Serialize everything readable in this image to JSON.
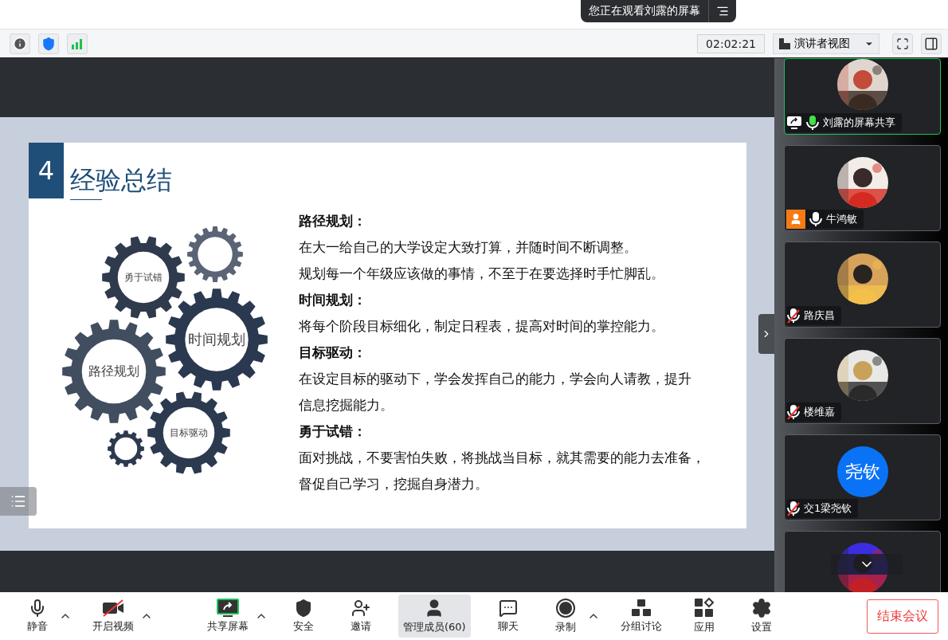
{
  "banner": {
    "text": "您正在观看刘露的屏幕"
  },
  "toolbar": {
    "timer": "02:02:21",
    "view_label": "演讲者视图"
  },
  "slide": {
    "number": "4",
    "title": "经验总结",
    "gears": [
      {
        "label": "勇于试错"
      },
      {
        "label": "时间规划"
      },
      {
        "label": "路径规划"
      },
      {
        "label": "目标驱动"
      }
    ],
    "lines": [
      {
        "kind": "heading",
        "text": "路径规划："
      },
      {
        "kind": "body",
        "text": "在大一给自己的大学设定大致打算，并随时间不断调整。"
      },
      {
        "kind": "body",
        "text": "规划每一个年级应该做的事情，不至于在要选择时手忙脚乱。"
      },
      {
        "kind": "heading",
        "text": "时间规划："
      },
      {
        "kind": "body",
        "text": "将每个阶段目标细化，制定日程表，提高对时间的掌控能力。"
      },
      {
        "kind": "heading",
        "text": "目标驱动："
      },
      {
        "kind": "body",
        "text": "在设定目标的驱动下，学会发挥自己的能力，学会向人请教，提升"
      },
      {
        "kind": "body",
        "text": "信息挖掘能力。"
      },
      {
        "kind": "heading",
        "text": "勇于试错："
      },
      {
        "kind": "body",
        "text": "面对挑战，不要害怕失败，将挑战当目标，就其需要的能力去准备，"
      },
      {
        "kind": "body",
        "text": "督促自己学习，挖掘自身潜力。"
      }
    ]
  },
  "participants": [
    {
      "name": "刘露的屏幕共享",
      "sharing_screen": true,
      "host": false,
      "muted": false,
      "speaking": true,
      "selected": true
    },
    {
      "name": "牛鸿敏",
      "sharing_screen": false,
      "host": true,
      "muted": false,
      "speaking": false,
      "selected": false
    },
    {
      "name": "路庆昌",
      "sharing_screen": false,
      "host": false,
      "muted": true,
      "speaking": false,
      "selected": false
    },
    {
      "name": "楼维嘉",
      "sharing_screen": false,
      "host": false,
      "muted": true,
      "speaking": false,
      "selected": false
    },
    {
      "name": "交1梁尧钦",
      "sharing_screen": false,
      "host": false,
      "muted": true,
      "speaking": false,
      "selected": false,
      "avatar": {
        "kind": "initials",
        "text": "尧钦"
      }
    },
    {
      "selected": false
    }
  ],
  "controls": [
    {
      "kind": "mic",
      "label": "静音",
      "menu": true,
      "selected": false
    },
    {
      "kind": "video",
      "label": "开启视频",
      "menu": true,
      "selected": false
    },
    {
      "kind": "share",
      "label": "共享屏幕",
      "menu": true,
      "selected": false
    },
    {
      "kind": "security",
      "label": "安全",
      "menu": false,
      "selected": false
    },
    {
      "kind": "invite",
      "label": "邀请",
      "menu": false,
      "selected": false
    },
    {
      "kind": "members",
      "label": "管理成员(60)",
      "menu": false,
      "selected": true
    },
    {
      "kind": "chat",
      "label": "聊天",
      "menu": false,
      "selected": false
    },
    {
      "kind": "record",
      "label": "录制",
      "menu": true,
      "selected": false
    },
    {
      "kind": "breakout",
      "label": "分组讨论",
      "menu": false,
      "selected": false
    },
    {
      "kind": "apps",
      "label": "应用",
      "menu": false,
      "selected": false
    },
    {
      "kind": "settings",
      "label": "设置",
      "menu": false,
      "selected": false
    }
  ],
  "end_button": "结束会议"
}
